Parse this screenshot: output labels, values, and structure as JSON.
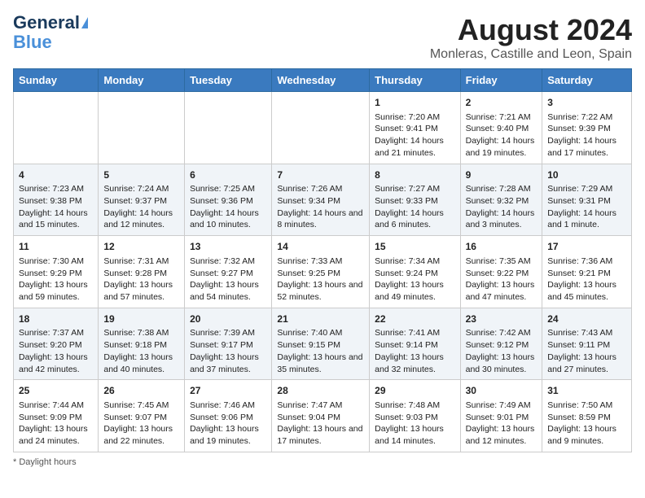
{
  "logo": {
    "line1": "General",
    "line2": "Blue"
  },
  "title": "August 2024",
  "subtitle": "Monleras, Castille and Leon, Spain",
  "columns": [
    "Sunday",
    "Monday",
    "Tuesday",
    "Wednesday",
    "Thursday",
    "Friday",
    "Saturday"
  ],
  "weeks": [
    [
      {
        "day": "",
        "info": ""
      },
      {
        "day": "",
        "info": ""
      },
      {
        "day": "",
        "info": ""
      },
      {
        "day": "",
        "info": ""
      },
      {
        "day": "1",
        "info": "Sunrise: 7:20 AM\nSunset: 9:41 PM\nDaylight: 14 hours and 21 minutes."
      },
      {
        "day": "2",
        "info": "Sunrise: 7:21 AM\nSunset: 9:40 PM\nDaylight: 14 hours and 19 minutes."
      },
      {
        "day": "3",
        "info": "Sunrise: 7:22 AM\nSunset: 9:39 PM\nDaylight: 14 hours and 17 minutes."
      }
    ],
    [
      {
        "day": "4",
        "info": "Sunrise: 7:23 AM\nSunset: 9:38 PM\nDaylight: 14 hours and 15 minutes."
      },
      {
        "day": "5",
        "info": "Sunrise: 7:24 AM\nSunset: 9:37 PM\nDaylight: 14 hours and 12 minutes."
      },
      {
        "day": "6",
        "info": "Sunrise: 7:25 AM\nSunset: 9:36 PM\nDaylight: 14 hours and 10 minutes."
      },
      {
        "day": "7",
        "info": "Sunrise: 7:26 AM\nSunset: 9:34 PM\nDaylight: 14 hours and 8 minutes."
      },
      {
        "day": "8",
        "info": "Sunrise: 7:27 AM\nSunset: 9:33 PM\nDaylight: 14 hours and 6 minutes."
      },
      {
        "day": "9",
        "info": "Sunrise: 7:28 AM\nSunset: 9:32 PM\nDaylight: 14 hours and 3 minutes."
      },
      {
        "day": "10",
        "info": "Sunrise: 7:29 AM\nSunset: 9:31 PM\nDaylight: 14 hours and 1 minute."
      }
    ],
    [
      {
        "day": "11",
        "info": "Sunrise: 7:30 AM\nSunset: 9:29 PM\nDaylight: 13 hours and 59 minutes."
      },
      {
        "day": "12",
        "info": "Sunrise: 7:31 AM\nSunset: 9:28 PM\nDaylight: 13 hours and 57 minutes."
      },
      {
        "day": "13",
        "info": "Sunrise: 7:32 AM\nSunset: 9:27 PM\nDaylight: 13 hours and 54 minutes."
      },
      {
        "day": "14",
        "info": "Sunrise: 7:33 AM\nSunset: 9:25 PM\nDaylight: 13 hours and 52 minutes."
      },
      {
        "day": "15",
        "info": "Sunrise: 7:34 AM\nSunset: 9:24 PM\nDaylight: 13 hours and 49 minutes."
      },
      {
        "day": "16",
        "info": "Sunrise: 7:35 AM\nSunset: 9:22 PM\nDaylight: 13 hours and 47 minutes."
      },
      {
        "day": "17",
        "info": "Sunrise: 7:36 AM\nSunset: 9:21 PM\nDaylight: 13 hours and 45 minutes."
      }
    ],
    [
      {
        "day": "18",
        "info": "Sunrise: 7:37 AM\nSunset: 9:20 PM\nDaylight: 13 hours and 42 minutes."
      },
      {
        "day": "19",
        "info": "Sunrise: 7:38 AM\nSunset: 9:18 PM\nDaylight: 13 hours and 40 minutes."
      },
      {
        "day": "20",
        "info": "Sunrise: 7:39 AM\nSunset: 9:17 PM\nDaylight: 13 hours and 37 minutes."
      },
      {
        "day": "21",
        "info": "Sunrise: 7:40 AM\nSunset: 9:15 PM\nDaylight: 13 hours and 35 minutes."
      },
      {
        "day": "22",
        "info": "Sunrise: 7:41 AM\nSunset: 9:14 PM\nDaylight: 13 hours and 32 minutes."
      },
      {
        "day": "23",
        "info": "Sunrise: 7:42 AM\nSunset: 9:12 PM\nDaylight: 13 hours and 30 minutes."
      },
      {
        "day": "24",
        "info": "Sunrise: 7:43 AM\nSunset: 9:11 PM\nDaylight: 13 hours and 27 minutes."
      }
    ],
    [
      {
        "day": "25",
        "info": "Sunrise: 7:44 AM\nSunset: 9:09 PM\nDaylight: 13 hours and 24 minutes."
      },
      {
        "day": "26",
        "info": "Sunrise: 7:45 AM\nSunset: 9:07 PM\nDaylight: 13 hours and 22 minutes."
      },
      {
        "day": "27",
        "info": "Sunrise: 7:46 AM\nSunset: 9:06 PM\nDaylight: 13 hours and 19 minutes."
      },
      {
        "day": "28",
        "info": "Sunrise: 7:47 AM\nSunset: 9:04 PM\nDaylight: 13 hours and 17 minutes."
      },
      {
        "day": "29",
        "info": "Sunrise: 7:48 AM\nSunset: 9:03 PM\nDaylight: 13 hours and 14 minutes."
      },
      {
        "day": "30",
        "info": "Sunrise: 7:49 AM\nSunset: 9:01 PM\nDaylight: 13 hours and 12 minutes."
      },
      {
        "day": "31",
        "info": "Sunrise: 7:50 AM\nSunset: 8:59 PM\nDaylight: 13 hours and 9 minutes."
      }
    ]
  ],
  "footer": "Daylight hours"
}
